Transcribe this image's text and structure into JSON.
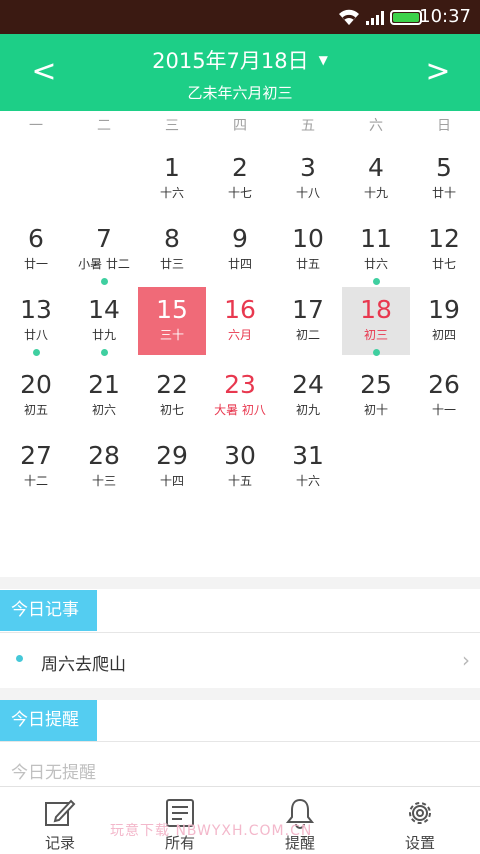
{
  "status_bar": {
    "time": "10:37"
  },
  "header": {
    "prev_label": "<",
    "next_label": ">",
    "date_main": "2015年7月18日",
    "caret": "▼",
    "date_lunar": "乙未年六月初三"
  },
  "weekdays": [
    "一",
    "二",
    "三",
    "四",
    "五",
    "六",
    "日"
  ],
  "calendar": {
    "weeks": [
      [
        null,
        null,
        {
          "day": "1",
          "lunar": "十六"
        },
        {
          "day": "2",
          "lunar": "十七"
        },
        {
          "day": "3",
          "lunar": "十八"
        },
        {
          "day": "4",
          "lunar": "十九"
        },
        {
          "day": "5",
          "lunar": "廿十"
        }
      ],
      [
        {
          "day": "6",
          "lunar": "廿一"
        },
        {
          "day": "7",
          "lunar": "小暑 廿二",
          "dot": true
        },
        {
          "day": "8",
          "lunar": "廿三"
        },
        {
          "day": "9",
          "lunar": "廿四"
        },
        {
          "day": "10",
          "lunar": "廿五"
        },
        {
          "day": "11",
          "lunar": "廿六",
          "dot": true
        },
        {
          "day": "12",
          "lunar": "廿七"
        }
      ],
      [
        {
          "day": "13",
          "lunar": "廿八",
          "dot": true
        },
        {
          "day": "14",
          "lunar": "廿九",
          "dot": true
        },
        {
          "day": "15",
          "lunar": "三十",
          "state": "selected"
        },
        {
          "day": "16",
          "lunar": "六月",
          "state": "red"
        },
        {
          "day": "17",
          "lunar": "初二"
        },
        {
          "day": "18",
          "lunar": "初三",
          "state": "viewing",
          "dot": true
        },
        {
          "day": "19",
          "lunar": "初四"
        }
      ],
      [
        {
          "day": "20",
          "lunar": "初五"
        },
        {
          "day": "21",
          "lunar": "初六"
        },
        {
          "day": "22",
          "lunar": "初七"
        },
        {
          "day": "23",
          "lunar": "大暑 初八",
          "state": "red"
        },
        {
          "day": "24",
          "lunar": "初九"
        },
        {
          "day": "25",
          "lunar": "初十"
        },
        {
          "day": "26",
          "lunar": "十一"
        }
      ],
      [
        {
          "day": "27",
          "lunar": "十二"
        },
        {
          "day": "28",
          "lunar": "十三"
        },
        {
          "day": "29",
          "lunar": "十四"
        },
        {
          "day": "30",
          "lunar": "十五"
        },
        {
          "day": "31",
          "lunar": "十六"
        },
        null,
        null
      ]
    ]
  },
  "notes_section": {
    "title": "今日记事",
    "items": [
      "周六去爬山"
    ]
  },
  "reminders_section": {
    "title": "今日提醒",
    "empty_text": "今日无提醒"
  },
  "tabbar": {
    "tabs": [
      {
        "label": "记录",
        "icon": "edit-icon"
      },
      {
        "label": "所有",
        "icon": "list-icon"
      },
      {
        "label": "提醒",
        "icon": "bell-icon"
      },
      {
        "label": "设置",
        "icon": "gear-icon"
      }
    ]
  },
  "watermark": "玩意下载 NBWYXH.COM.CN",
  "colors": {
    "header": "#1dcf87",
    "selected": "#f06a78",
    "accent_red": "#e8384f",
    "section_tag": "#54cdf1",
    "dot": "#3fcfa0"
  }
}
